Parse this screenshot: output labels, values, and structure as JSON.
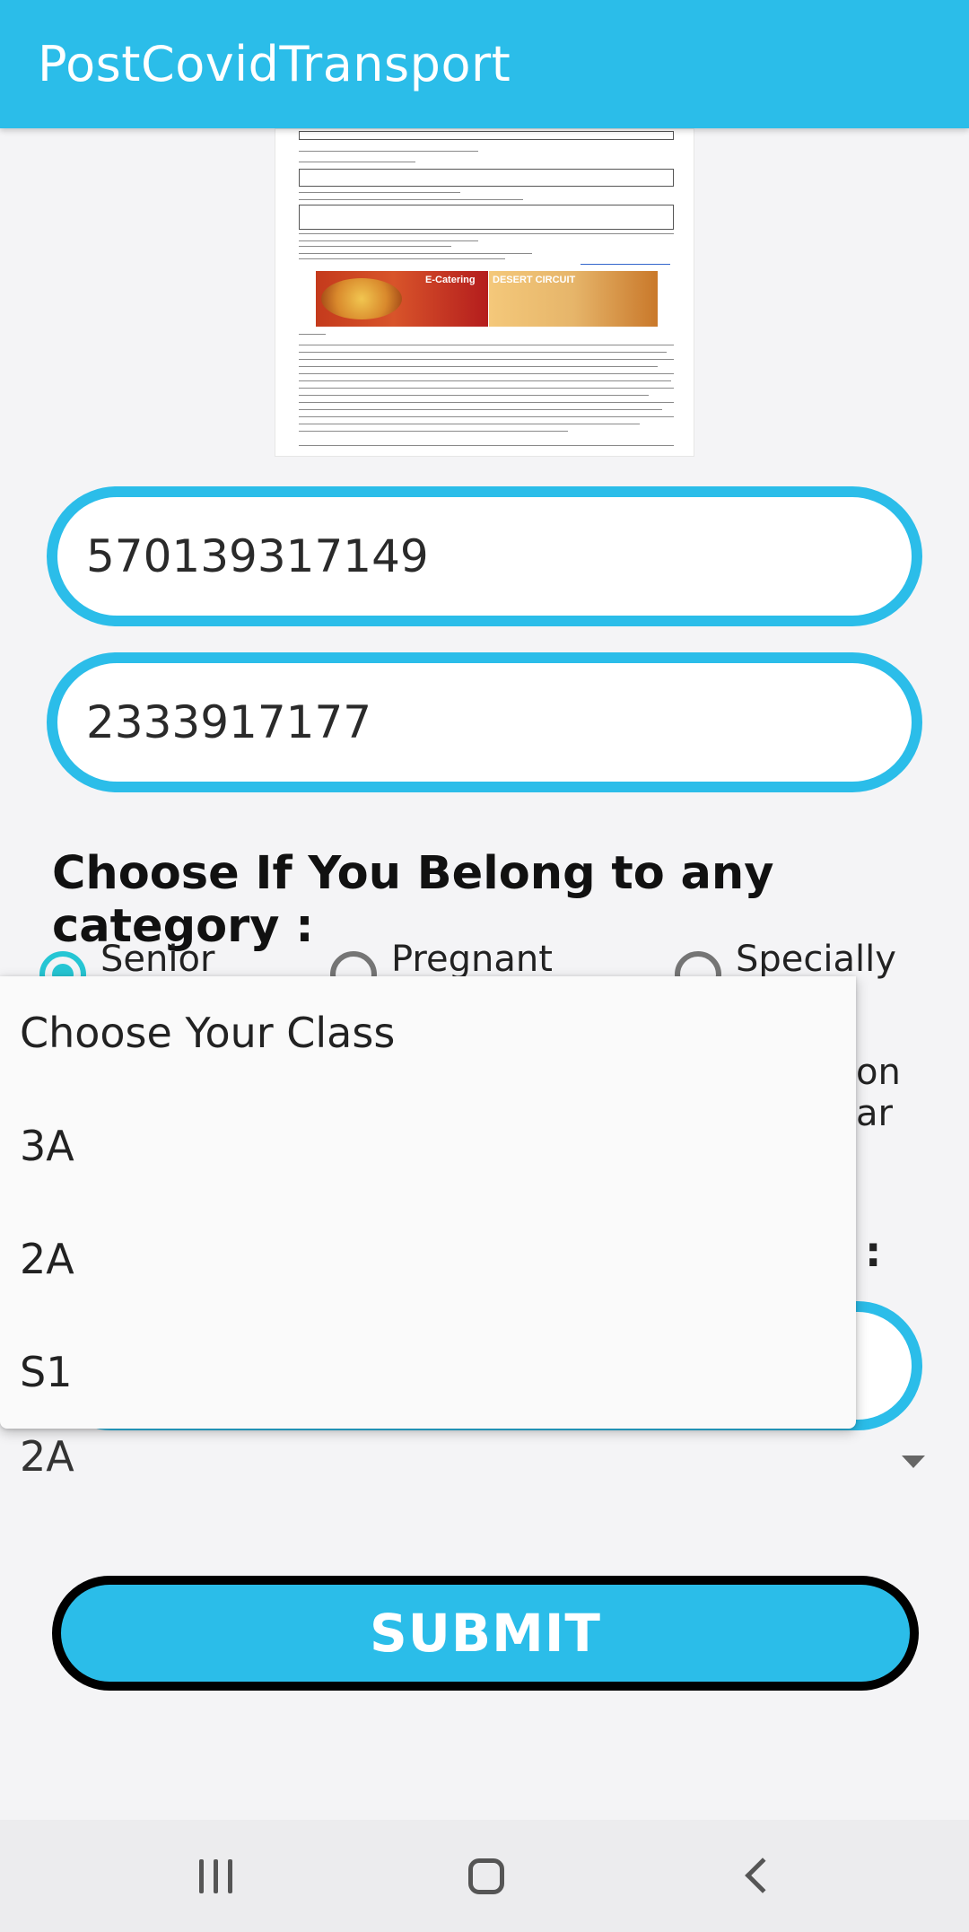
{
  "app": {
    "title": "PostCovidTransport"
  },
  "form": {
    "pnr_value": "570139317149",
    "train_value": "2333917177",
    "category_heading": "Choose If You Belong to any category :",
    "categories": [
      {
        "label": "Senior",
        "selected": true
      },
      {
        "label": "Pregnant",
        "selected": false
      },
      {
        "label": "Specially",
        "selected": false
      }
    ],
    "hidden_fragments": {
      "line1": "on",
      "line2": "ar",
      "colon": ":"
    },
    "class_selected": "2A",
    "submit_label": "SUBMIT"
  },
  "dropdown": {
    "options": [
      "Choose Your Class",
      "3A",
      "2A",
      "S1"
    ]
  },
  "colors": {
    "accent": "#2bbde9",
    "radio_selected": "#26c6d4",
    "submit_border": "#000000"
  },
  "navbar": {
    "icons": [
      "recent-apps-icon",
      "home-icon",
      "back-icon"
    ]
  }
}
